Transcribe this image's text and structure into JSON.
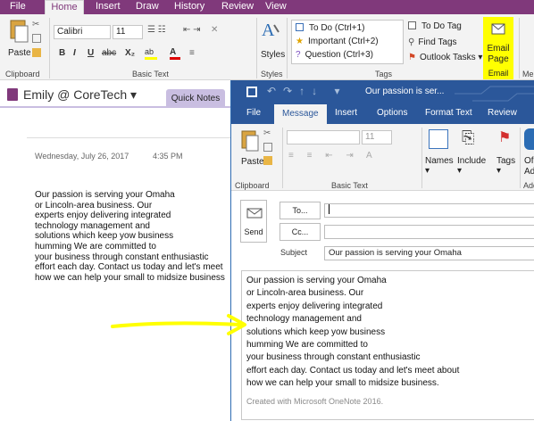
{
  "onenote": {
    "tabs": [
      "File",
      "Home",
      "Insert",
      "Draw",
      "History",
      "Review",
      "View"
    ],
    "active_tab": "Home",
    "clipboard": {
      "paste_label": "Paste",
      "group": "Clipboard"
    },
    "basic_text": {
      "font": "Calibri",
      "size": "11",
      "group": "Basic Text"
    },
    "styles": {
      "label": "Styles",
      "group": "Styles"
    },
    "tags": {
      "items": [
        "To Do (Ctrl+1)",
        "Important (Ctrl+2)",
        "Question (Ctrl+3)"
      ],
      "todo_tag": "To Do Tag",
      "find_tags": "Find Tags",
      "outlook_tasks": "Outlook Tasks",
      "group": "Tags"
    },
    "email": {
      "label_line1": "Email",
      "label_line2": "Page",
      "group": "Email",
      "me_group": "Me"
    },
    "notebook": "Emily @ CoreTech",
    "section_tab": "Quick Notes",
    "date": "Wednesday, July 26, 2017",
    "time": "4:35 PM",
    "note_text": "Our passion is serving your Omaha\nor Lincoln-area business. Our\nexperts enjoy delivering integrated\ntechnology management and\nsolutions which keep yow business\nhumming We are committed to\nyour business through constant enthusiastic\neffort each day. Contact us today and let's meet\nhow we can help your small to midsize business"
  },
  "outlook": {
    "window_title": "Our passion is ser...",
    "tabs": [
      "File",
      "Message",
      "Insert",
      "Options",
      "Format Text",
      "Review"
    ],
    "active_tab": "Message",
    "ribbon": {
      "paste": "Paste",
      "clipboard": "Clipboard",
      "font_size": "11",
      "basic_text": "Basic Text",
      "names": "Names",
      "include": "Include",
      "tags": "Tags",
      "office_line1": "Of",
      "office_line2": "Ad",
      "add_group": "Add"
    },
    "send": "Send",
    "to": "To...",
    "cc": "Cc...",
    "subject_label": "Subject",
    "subject": "Our passion is serving your Omaha",
    "body": "Our passion is serving your Omaha\nor Lincoln-area business. Our\nexperts enjoy delivering integrated\ntechnology management and\nsolutions which keep yow business\nhumming We are committed to\nyour business through constant enthusiastic\neffort each day. Contact us today and let's meet about\nhow we can help your small to midsize business.",
    "signature": "Created with Microsoft OneNote 2016."
  },
  "colors": {
    "onenote": "#80397b",
    "outlook": "#2b579a",
    "highlight": "#ffff00"
  }
}
